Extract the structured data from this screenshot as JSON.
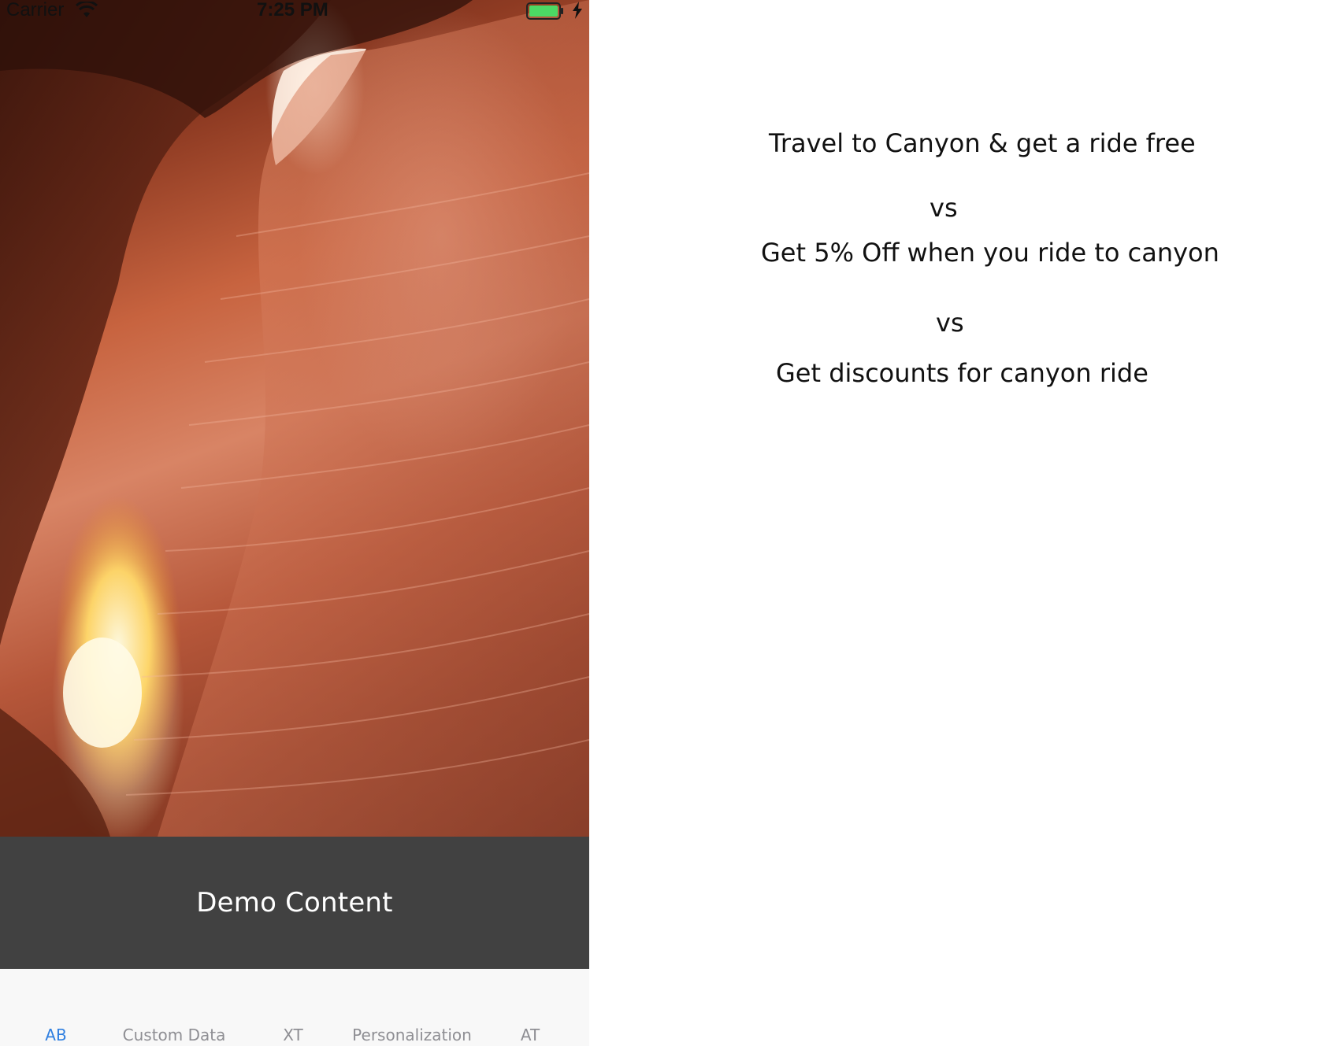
{
  "status_bar": {
    "carrier": "Carrier",
    "time": "7:25 PM",
    "battery_color": "#4cd964"
  },
  "hero": {
    "icon": "canyon-photo"
  },
  "demo_bar": {
    "label": "Demo Content",
    "background": "#414141"
  },
  "tabs": [
    {
      "label": "AB",
      "active": true
    },
    {
      "label": "Custom Data",
      "active": false
    },
    {
      "label": "XT",
      "active": false
    },
    {
      "label": "Personalization",
      "active": false
    },
    {
      "label": "AT",
      "active": false
    }
  ],
  "accent_color": "#2f7fe0",
  "notes": {
    "line1": "Travel to Canyon & get a ride free",
    "vs1": "vs",
    "line2": "Get 5% Off when you ride to canyon",
    "vs2": "vs",
    "line3": "Get discounts for canyon ride"
  }
}
